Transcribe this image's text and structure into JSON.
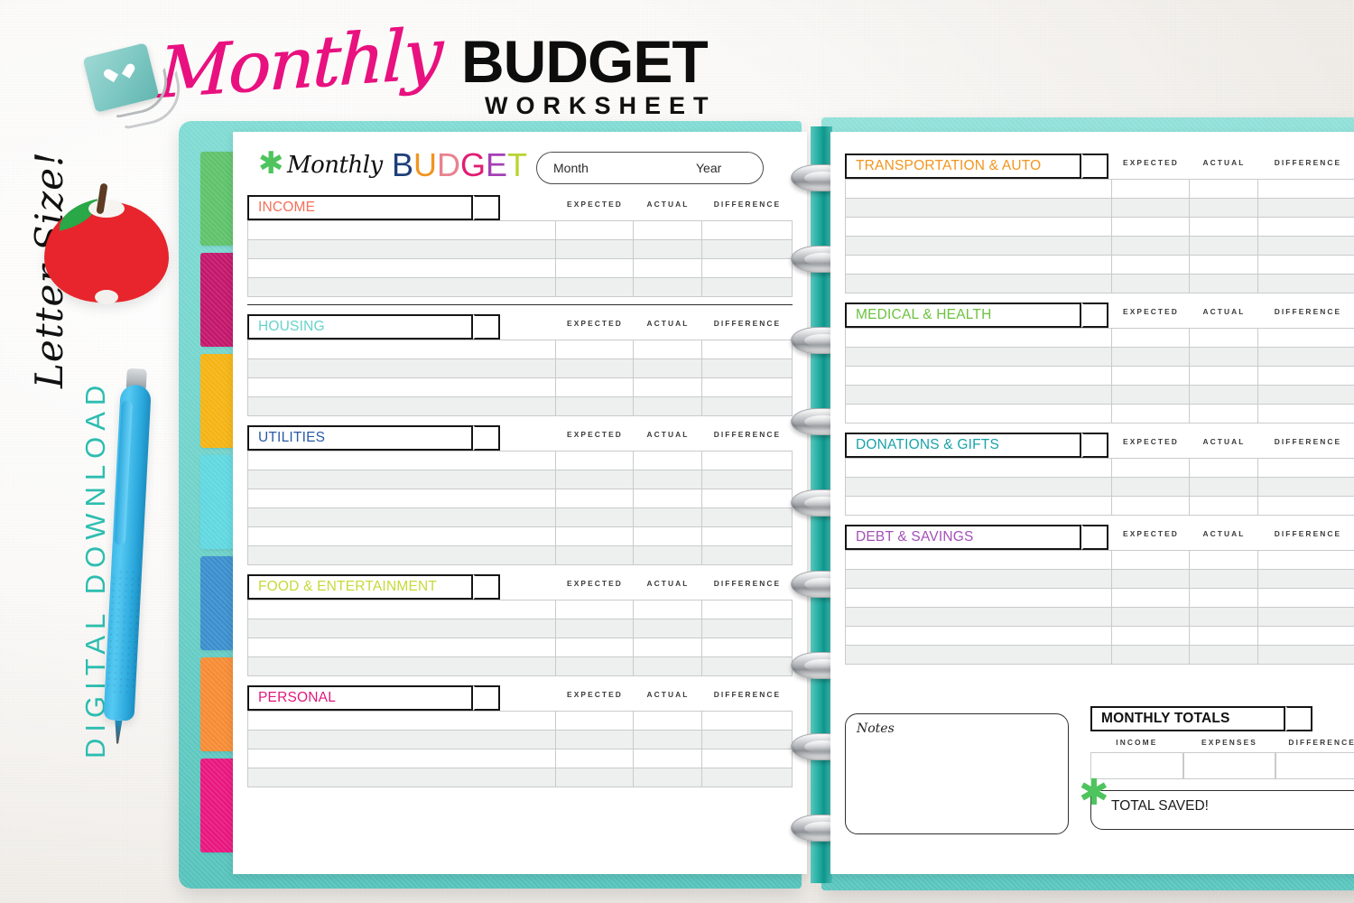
{
  "promo": {
    "title_script": "Monthly",
    "title_main": "BUDGET",
    "title_sub": "WORKSHEET",
    "letter_size": "Letter Size!",
    "digital_download": "DIGITAL DOWNLOAD"
  },
  "colors": {
    "script_pink": "#e8117f",
    "teal_cover": "#6ed2ca",
    "apple_red": "#e8252c",
    "leaf_green": "#2aa747",
    "pen_blue": "#3fb8e8",
    "download_teal": "#2dbdb0",
    "star_green": "#4ec45e",
    "row_alt": "#eeefef",
    "grid_line": "#c9cacc",
    "banner_border": "#151515"
  },
  "tabs": [
    {
      "name": "tab-green",
      "color": "#5ec269"
    },
    {
      "name": "tab-magenta",
      "color": "#c3156b"
    },
    {
      "name": "tab-amber",
      "color": "#f5b312"
    },
    {
      "name": "tab-cyan",
      "color": "#5fd7e0"
    },
    {
      "name": "tab-blue",
      "color": "#3a8ecd"
    },
    {
      "name": "tab-orange",
      "color": "#f68b33"
    },
    {
      "name": "tab-pink",
      "color": "#e9157e"
    }
  ],
  "worksheet": {
    "logo_star": "✱",
    "logo_script": "Monthly",
    "logo_budget_letters": [
      {
        "ch": "B",
        "color": "#1f3f7a"
      },
      {
        "ch": "U",
        "color": "#f0951f"
      },
      {
        "ch": "D",
        "color": "#e8828f"
      },
      {
        "ch": "G",
        "color": "#e11d73"
      },
      {
        "ch": "E",
        "color": "#a43fb5"
      },
      {
        "ch": "T",
        "color": "#b8d432"
      }
    ],
    "month_label": "Month",
    "year_label": "Year",
    "column_headers": [
      "EXPECTED",
      "ACTUAL",
      "DIFFERENCE"
    ]
  },
  "left_page_sections": [
    {
      "title": "INCOME",
      "color": "#f4705a",
      "rows": 4,
      "banner_width": 250,
      "divider_after": true
    },
    {
      "title": "HOUSING",
      "color": "#67d3cb",
      "rows": 4,
      "banner_width": 250,
      "divider_after": false
    },
    {
      "title": "UTILITIES",
      "color": "#2a5aa8",
      "rows": 6,
      "banner_width": 250,
      "divider_after": false
    },
    {
      "title": "FOOD & ENTERTAINMENT",
      "color": "#c6da3a",
      "rows": 4,
      "banner_width": 250,
      "divider_after": false
    },
    {
      "title": "PERSONAL",
      "color": "#e0197d",
      "rows": 4,
      "banner_width": 250,
      "divider_after": false
    }
  ],
  "right_page_sections": [
    {
      "title": "TRANSPORTATION & AUTO",
      "color": "#f2951d",
      "rows": 6,
      "banner_width": 262
    },
    {
      "title": "MEDICAL & HEALTH",
      "color": "#6cc23f",
      "rows": 5,
      "banner_width": 262
    },
    {
      "title": "DONATIONS & GIFTS",
      "color": "#19a3a8",
      "rows": 3,
      "banner_width": 262
    },
    {
      "title": "DEBT & SAVINGS",
      "color": "#a350b8",
      "rows": 6,
      "banner_width": 262
    }
  ],
  "notes": {
    "label": "Notes"
  },
  "monthly_totals": {
    "banner": "MONTHLY TOTALS",
    "columns": [
      "INCOME",
      "EXPENSES",
      "DIFFERENCE"
    ],
    "total_saved_label": "TOTAL SAVED!",
    "star": "✱"
  }
}
